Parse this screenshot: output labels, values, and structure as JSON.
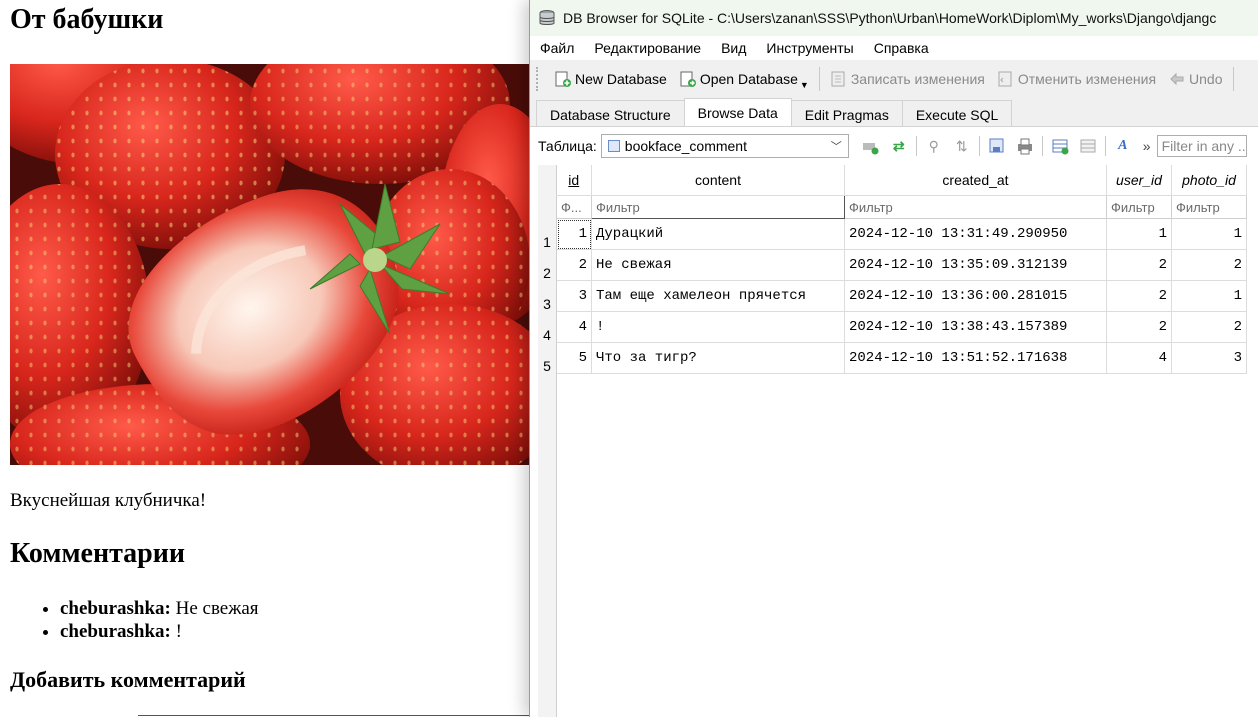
{
  "webpage": {
    "title": "От бабушки",
    "caption": "Вкуснейшая клубничка!",
    "comments_heading": "Комментарии",
    "comments": [
      {
        "user": "cheburashka:",
        "text": " Не свежая"
      },
      {
        "user": "cheburashka:",
        "text": " !"
      }
    ],
    "add_heading": "Добавить комментарий"
  },
  "window": {
    "title": "DB Browser for SQLite - C:\\Users\\zanan\\SSS\\Python\\Urban\\HomeWork\\Diplom\\My_works\\Django\\djangc",
    "menu": [
      "Файл",
      "Редактирование",
      "Вид",
      "Инструменты",
      "Справка"
    ],
    "toolbar": {
      "new_db": "New Database",
      "open_db": "Open Database",
      "write": "Записать изменения",
      "revert": "Отменить изменения",
      "undo": "Undo"
    },
    "tabs": [
      "Database Structure",
      "Browse Data",
      "Edit Pragmas",
      "Execute SQL"
    ],
    "active_tab": "Browse Data",
    "table_label": "Таблица:",
    "table_name": "bookface_comment",
    "more": "»",
    "filter_all_placeholder": "Filter in any ..."
  },
  "grid": {
    "columns": [
      {
        "name": "id",
        "filter": "Ф..."
      },
      {
        "name": "content",
        "filter": "Фильтр"
      },
      {
        "name": "created_at",
        "filter": "Фильтр"
      },
      {
        "name": "user_id",
        "filter": "Фильтр"
      },
      {
        "name": "photo_id",
        "filter": "Фильтр"
      }
    ],
    "rows": [
      {
        "rownum": "1",
        "id": "1",
        "content": "Дурацкий",
        "created_at": "2024-12-10 13:31:49.290950",
        "user_id": "1",
        "photo_id": "1"
      },
      {
        "rownum": "2",
        "id": "2",
        "content": "Не свежая",
        "created_at": "2024-12-10 13:35:09.312139",
        "user_id": "2",
        "photo_id": "2"
      },
      {
        "rownum": "3",
        "id": "3",
        "content": "Там еще хамелеон прячется",
        "created_at": "2024-12-10 13:36:00.281015",
        "user_id": "2",
        "photo_id": "1"
      },
      {
        "rownum": "4",
        "id": "4",
        "content": "!",
        "created_at": "2024-12-10 13:38:43.157389",
        "user_id": "2",
        "photo_id": "2"
      },
      {
        "rownum": "5",
        "id": "5",
        "content": "Что за тигр?",
        "created_at": "2024-12-10 13:51:52.171638",
        "user_id": "4",
        "photo_id": "3"
      }
    ]
  },
  "colors": {
    "titlebar": "#eff7ef",
    "window_bg": "#f0f0f0",
    "strawberry": "#d42a22"
  }
}
